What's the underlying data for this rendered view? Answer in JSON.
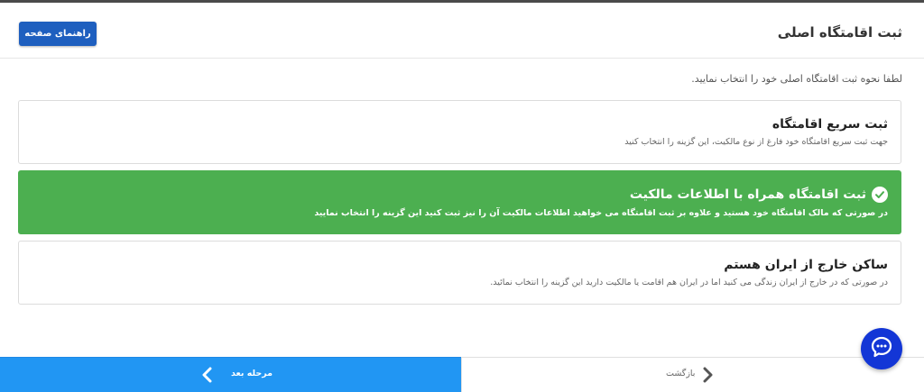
{
  "header": {
    "title": "ثبت اقامتگاه اصلی",
    "guide_button": "راهنمای صفحه"
  },
  "instruction": "لطفا نحوه ثبت اقامتگاه اصلی خود را انتخاب نمایید.",
  "options": [
    {
      "title": "ثبت سریع اقامتگاه",
      "description": "جهت ثبت سریع اقامتگاه خود فارغ از نوع مالکیت، این گزینه را انتخاب کنید",
      "selected": false
    },
    {
      "title": "ثبت اقامتگاه همراه با اطلاعات مالکیت",
      "description": "در صورتی که مالک اقامتگاه خود هستید و علاوه بر ثبت اقامتگاه می خواهید اطلاعات مالکیت آن را نیز ثبت کنید این گزینه را انتخاب نمایید",
      "selected": true
    },
    {
      "title": "ساکن خارج از ایران هستم",
      "description": "در صورتی که در خارج از ایران زندگی می کنید اما در ایران هم اقامت یا مالکیت دارید این گزینه را انتخاب نمائید.",
      "selected": false
    }
  ],
  "footer": {
    "next_label": "مرحله بعد",
    "back_label": "بازگشت"
  },
  "colors": {
    "primary": "#1e5fbf",
    "selected": "#4caf50",
    "footer_next": "#2196f3",
    "chat": "#1336d6"
  },
  "icons": {
    "check": "check-circle-icon",
    "next": "chevron-left-icon",
    "back": "chevron-right-icon",
    "chat": "chat-bubble-icon"
  }
}
